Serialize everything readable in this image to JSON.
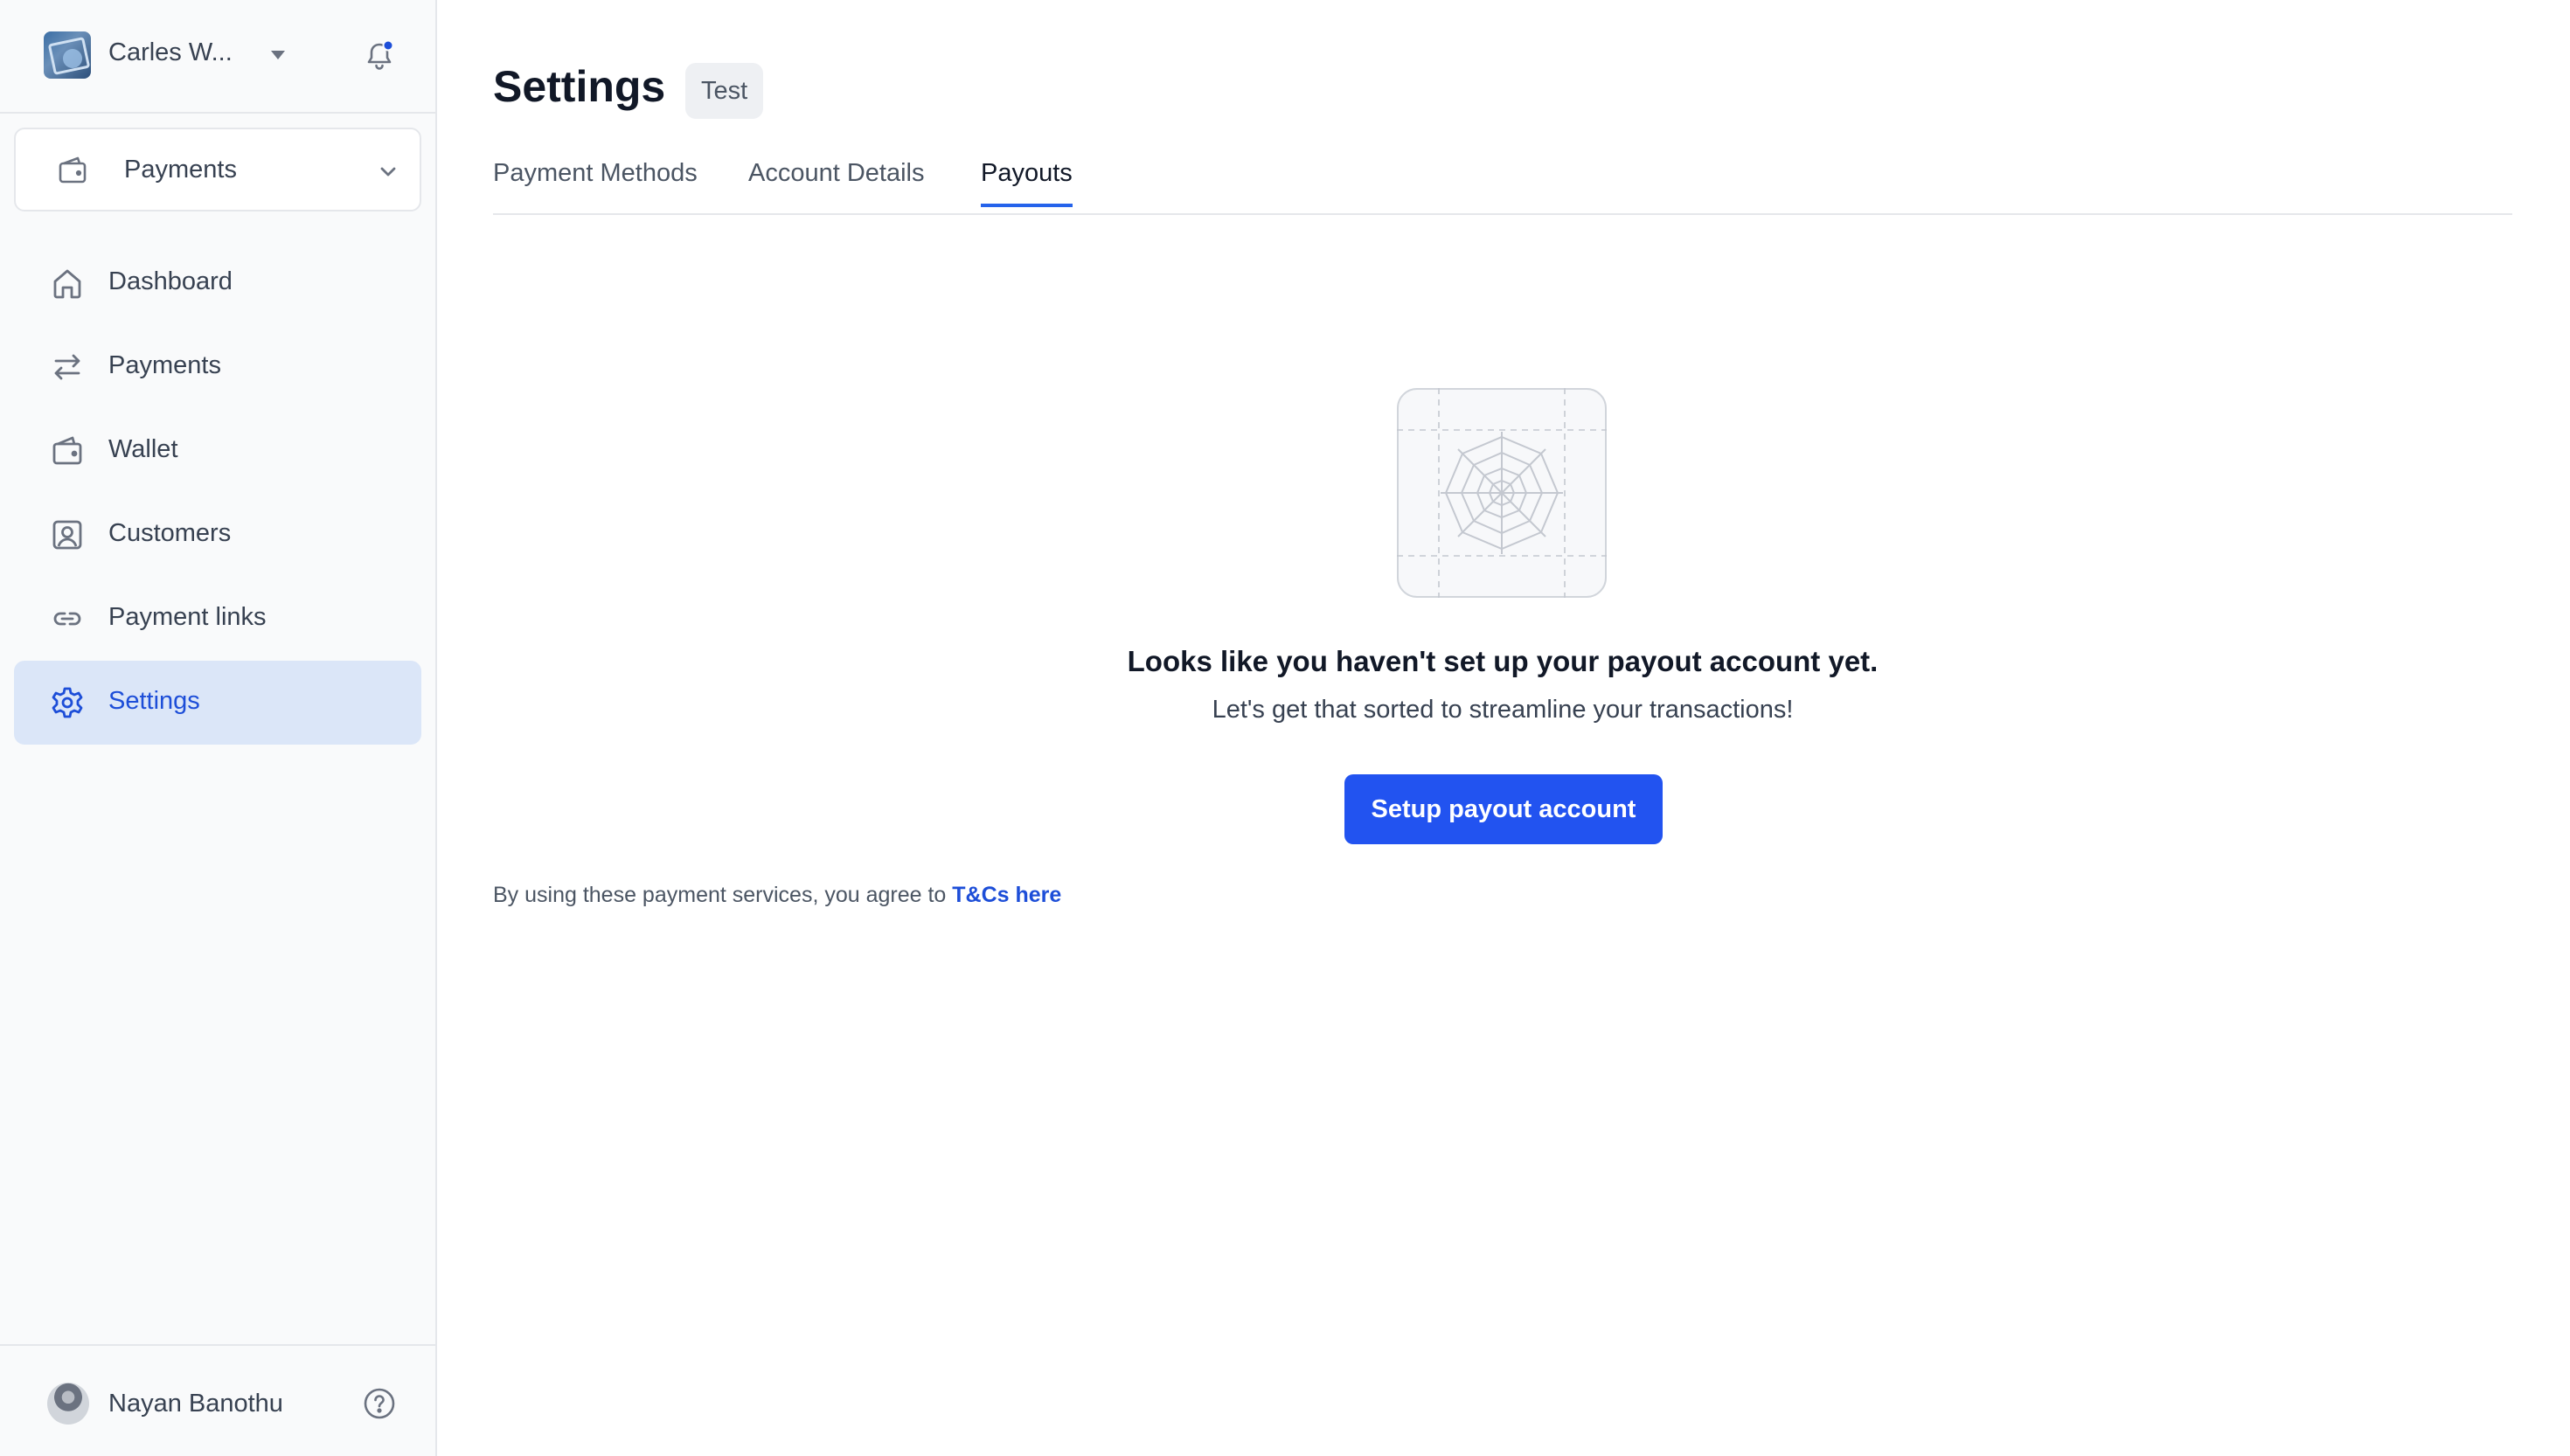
{
  "sidebar": {
    "org_name": "Carles W...",
    "module": {
      "label": "Payments"
    },
    "items": [
      {
        "label": "Dashboard",
        "icon": "home-icon"
      },
      {
        "label": "Payments",
        "icon": "arrows-exchange-icon"
      },
      {
        "label": "Wallet",
        "icon": "wallet-icon"
      },
      {
        "label": "Customers",
        "icon": "user-square-icon"
      },
      {
        "label": "Payment links",
        "icon": "link-icon"
      },
      {
        "label": "Settings",
        "icon": "gear-icon",
        "active": true
      }
    ],
    "user_name": "Nayan Banothu"
  },
  "main": {
    "title": "Settings",
    "badge": "Test",
    "tabs": [
      {
        "label": "Payment Methods"
      },
      {
        "label": "Account Details"
      },
      {
        "label": "Payouts",
        "active": true
      }
    ],
    "empty_state": {
      "title": "Looks like you haven't set up your payout account yet.",
      "subtitle": "Let's get that sorted to streamline your transactions!",
      "button": "Setup payout account"
    },
    "terms": {
      "text": "By using these payment services, you agree to ",
      "link": "T&Cs here"
    }
  },
  "colors": {
    "accent": "#2253f0",
    "active_nav_bg": "#dbe6f8",
    "notification_dot": "#1d4ed8"
  }
}
